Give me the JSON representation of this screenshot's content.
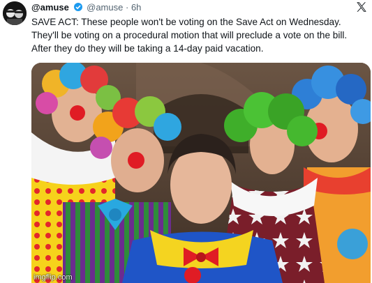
{
  "tweet": {
    "display_name": "@amuse",
    "handle": "@amuse",
    "separator": "·",
    "age": "6h",
    "text": "SAVE ACT: These people won't be voting on the Save Act on Wednesday. They'll be voting on a procedural motion that will preclude a vote on the bill. After they do they will be taking a 14-day paid vacation."
  },
  "icons": {
    "avatar": "avatar-image",
    "platform": "x-logo-icon"
  },
  "media": {
    "description_icon": "clown-group-photo",
    "watermark": "imgflip.com"
  },
  "colors": {
    "text": "#0f1419",
    "meta": "#536471",
    "background": "#ffffff"
  }
}
